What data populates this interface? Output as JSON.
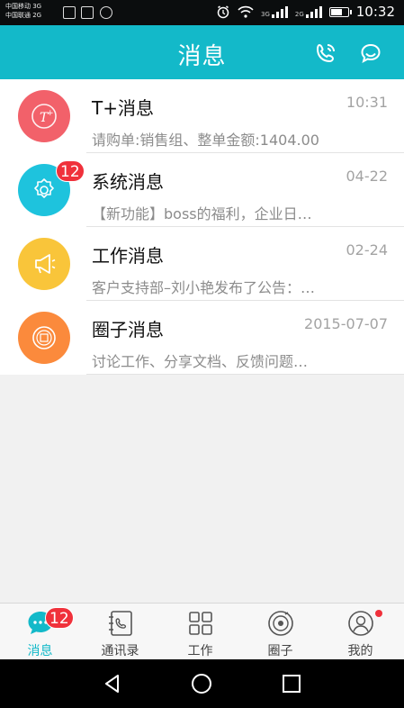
{
  "status_bar": {
    "carrier_1": "中国移动 3G",
    "carrier_2": "中国联通 2G",
    "net_3g": "3G",
    "net_2g": "2G",
    "time": "10:32",
    "battery_level": 0.7
  },
  "header": {
    "title": "消息",
    "actions": [
      {
        "icon": "phone-icon"
      },
      {
        "icon": "chat-bubble-icon"
      }
    ]
  },
  "messages": [
    {
      "title": "T+消息",
      "time": "10:31",
      "preview": "请购单:销售组、整单金额:1404.00",
      "avatar_color": "#f2616a",
      "icon": "t-plus-icon",
      "badge": ""
    },
    {
      "title": "系统消息",
      "time": "04-22",
      "preview": "【新功能】boss的福利，企业日…",
      "avatar_color": "#1ec3dd",
      "icon": "gear-icon",
      "badge": "12"
    },
    {
      "title": "工作消息",
      "time": "02-24",
      "preview": "客户支持部–刘小艳发布了公告：…",
      "avatar_color": "#f9c53a",
      "icon": "megaphone-icon",
      "badge": ""
    },
    {
      "title": "圈子消息",
      "time": "2015-07-07",
      "preview": "讨论工作、分享文档、反馈问题…",
      "avatar_color": "#fb8a3c",
      "icon": "circle-quan-icon",
      "badge": ""
    }
  ],
  "tabs": [
    {
      "label": "消息",
      "icon": "chat-dots-icon",
      "active": true,
      "badge": "12"
    },
    {
      "label": "通讯录",
      "icon": "contacts-icon",
      "active": false,
      "badge": ""
    },
    {
      "label": "工作",
      "icon": "grid-icon",
      "active": false,
      "badge": ""
    },
    {
      "label": "圈子",
      "icon": "circle-icon",
      "active": false,
      "badge": ""
    },
    {
      "label": "我的",
      "icon": "user-icon",
      "active": false,
      "badge": "dot"
    }
  ],
  "colors": {
    "accent": "#13b9c9",
    "badge": "#f0313b"
  },
  "nav": [
    "back-icon",
    "home-icon",
    "recents-icon"
  ]
}
